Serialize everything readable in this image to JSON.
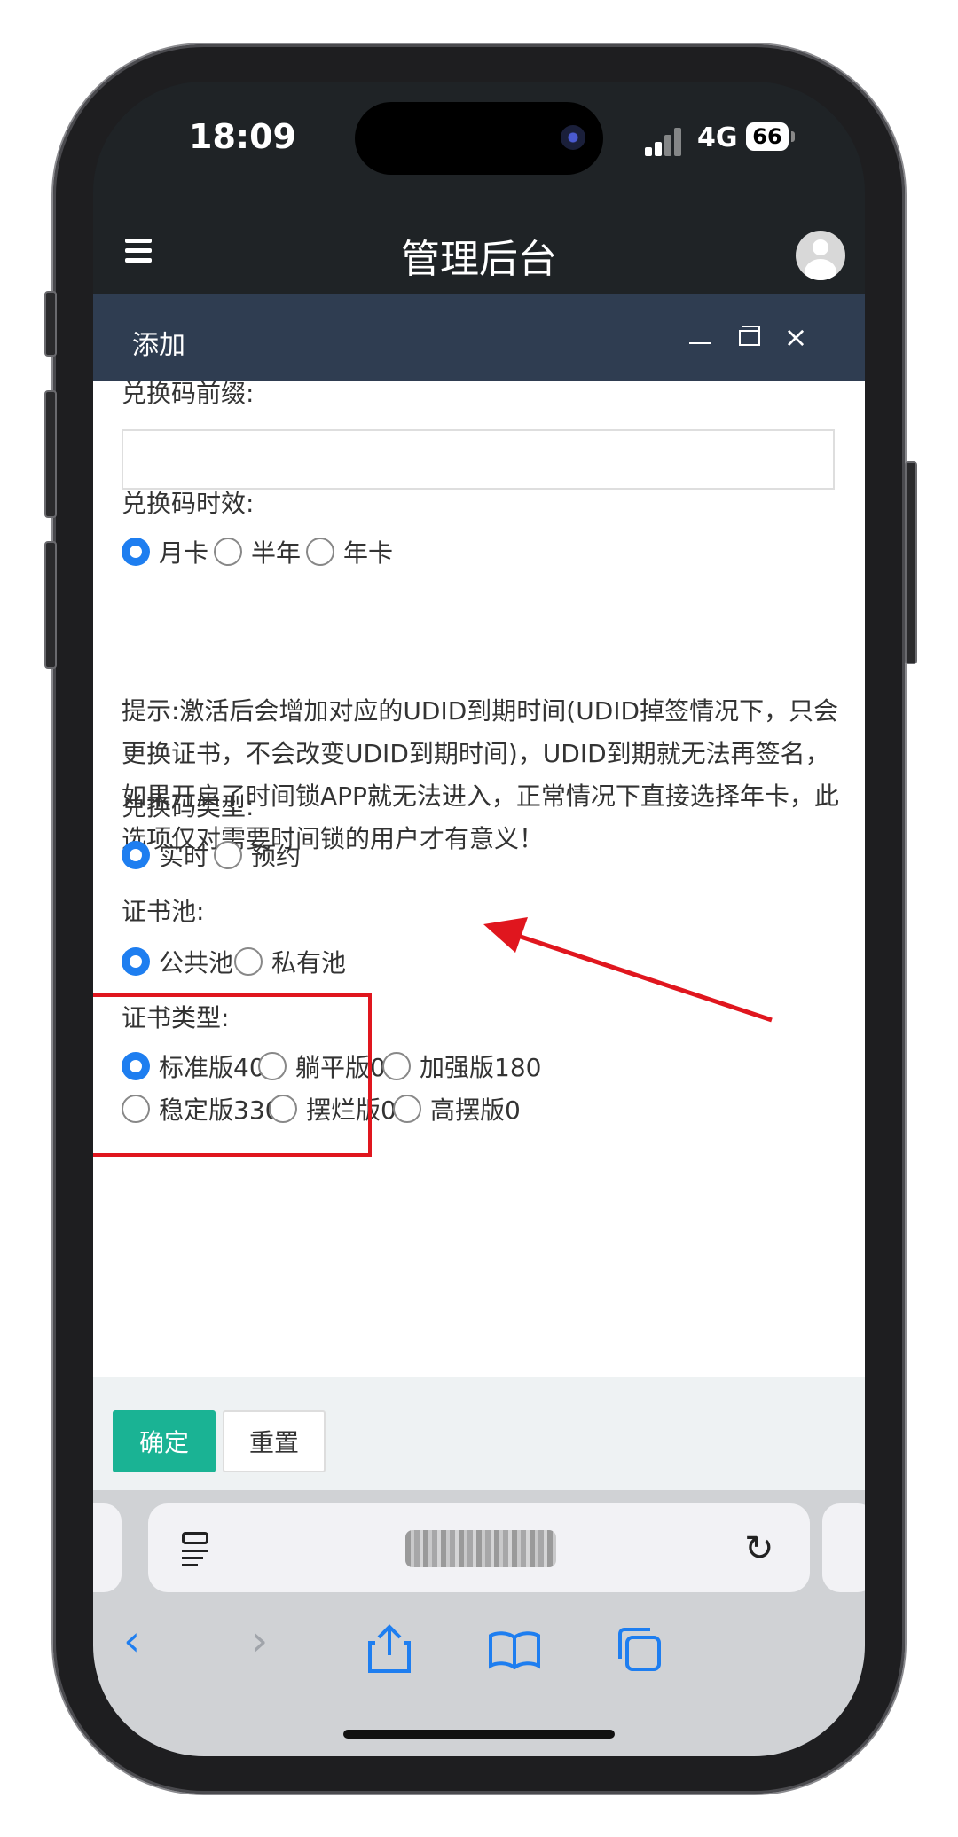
{
  "status": {
    "time": "18:09",
    "network": "4G",
    "battery": "66"
  },
  "app": {
    "title": "管理后台"
  },
  "dialog": {
    "title": "添加"
  },
  "form": {
    "prefix_label": "兑换码前缀:",
    "prefix_value": "",
    "validity_label": "兑换码时效:",
    "validity_options": [
      "月卡",
      "半年",
      "年卡"
    ],
    "validity_selected": "月卡",
    "tip": "提示:激活后会增加对应的UDID到期时间(UDID掉签情况下，只会更换证书，不会改变UDID到期时间)，UDID到期就无法再签名，如果开启了时间锁APP就无法进入，正常情况下直接选择年卡，此选项仅对需要时间锁的用户才有意义！",
    "type_label": "兑换码类型:",
    "type_options": [
      "实时",
      "预约"
    ],
    "type_selected": "实时",
    "pool_label": "证书池:",
    "pool_options": [
      "公共池",
      "私有池"
    ],
    "pool_selected": "公共池",
    "cert_label": "证书类型:",
    "cert_options": [
      "标准版40",
      "躺平版0",
      "加强版180",
      "稳定版330",
      "摆烂版0",
      "高摆版0"
    ],
    "cert_selected": "标准版40"
  },
  "footer": {
    "ok": "确定",
    "reset": "重置"
  },
  "colors": {
    "accent": "#1e7ef0",
    "ok": "#1ab394",
    "dialog_header": "#2f3d51",
    "highlight": "#e0161e"
  },
  "icons": [
    "menu-icon",
    "avatar",
    "minimize-icon",
    "maximize-icon",
    "close-icon",
    "reader-icon",
    "reload-icon",
    "back-icon",
    "forward-icon",
    "share-icon",
    "bookmarks-icon",
    "tabs-icon"
  ]
}
